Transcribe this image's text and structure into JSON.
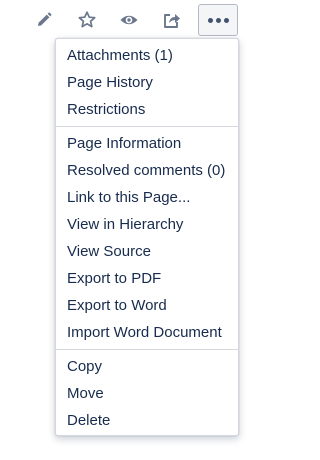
{
  "toolbar": {
    "buttons": [
      {
        "name": "edit",
        "icon": "pencil-icon"
      },
      {
        "name": "star",
        "icon": "star-icon"
      },
      {
        "name": "watch",
        "icon": "eye-icon"
      },
      {
        "name": "share",
        "icon": "share-icon"
      },
      {
        "name": "more",
        "icon": "more-dots-icon"
      }
    ]
  },
  "menu": {
    "sections": [
      {
        "items": [
          {
            "label": "Attachments (1)"
          },
          {
            "label": "Page History"
          },
          {
            "label": "Restrictions"
          }
        ]
      },
      {
        "items": [
          {
            "label": "Page Information"
          },
          {
            "label": "Resolved comments (0)"
          },
          {
            "label": "Link to this Page..."
          },
          {
            "label": "View in Hierarchy"
          },
          {
            "label": "View Source"
          },
          {
            "label": "Export to PDF"
          },
          {
            "label": "Export to Word"
          },
          {
            "label": "Import Word Document"
          }
        ]
      },
      {
        "items": [
          {
            "label": "Copy"
          },
          {
            "label": "Move"
          },
          {
            "label": "Delete"
          }
        ]
      }
    ]
  },
  "colors": {
    "text": "#172b4d",
    "icon": "#6b778c",
    "border": "#d5d9df",
    "active_button_bg": "#f4f5f7"
  }
}
